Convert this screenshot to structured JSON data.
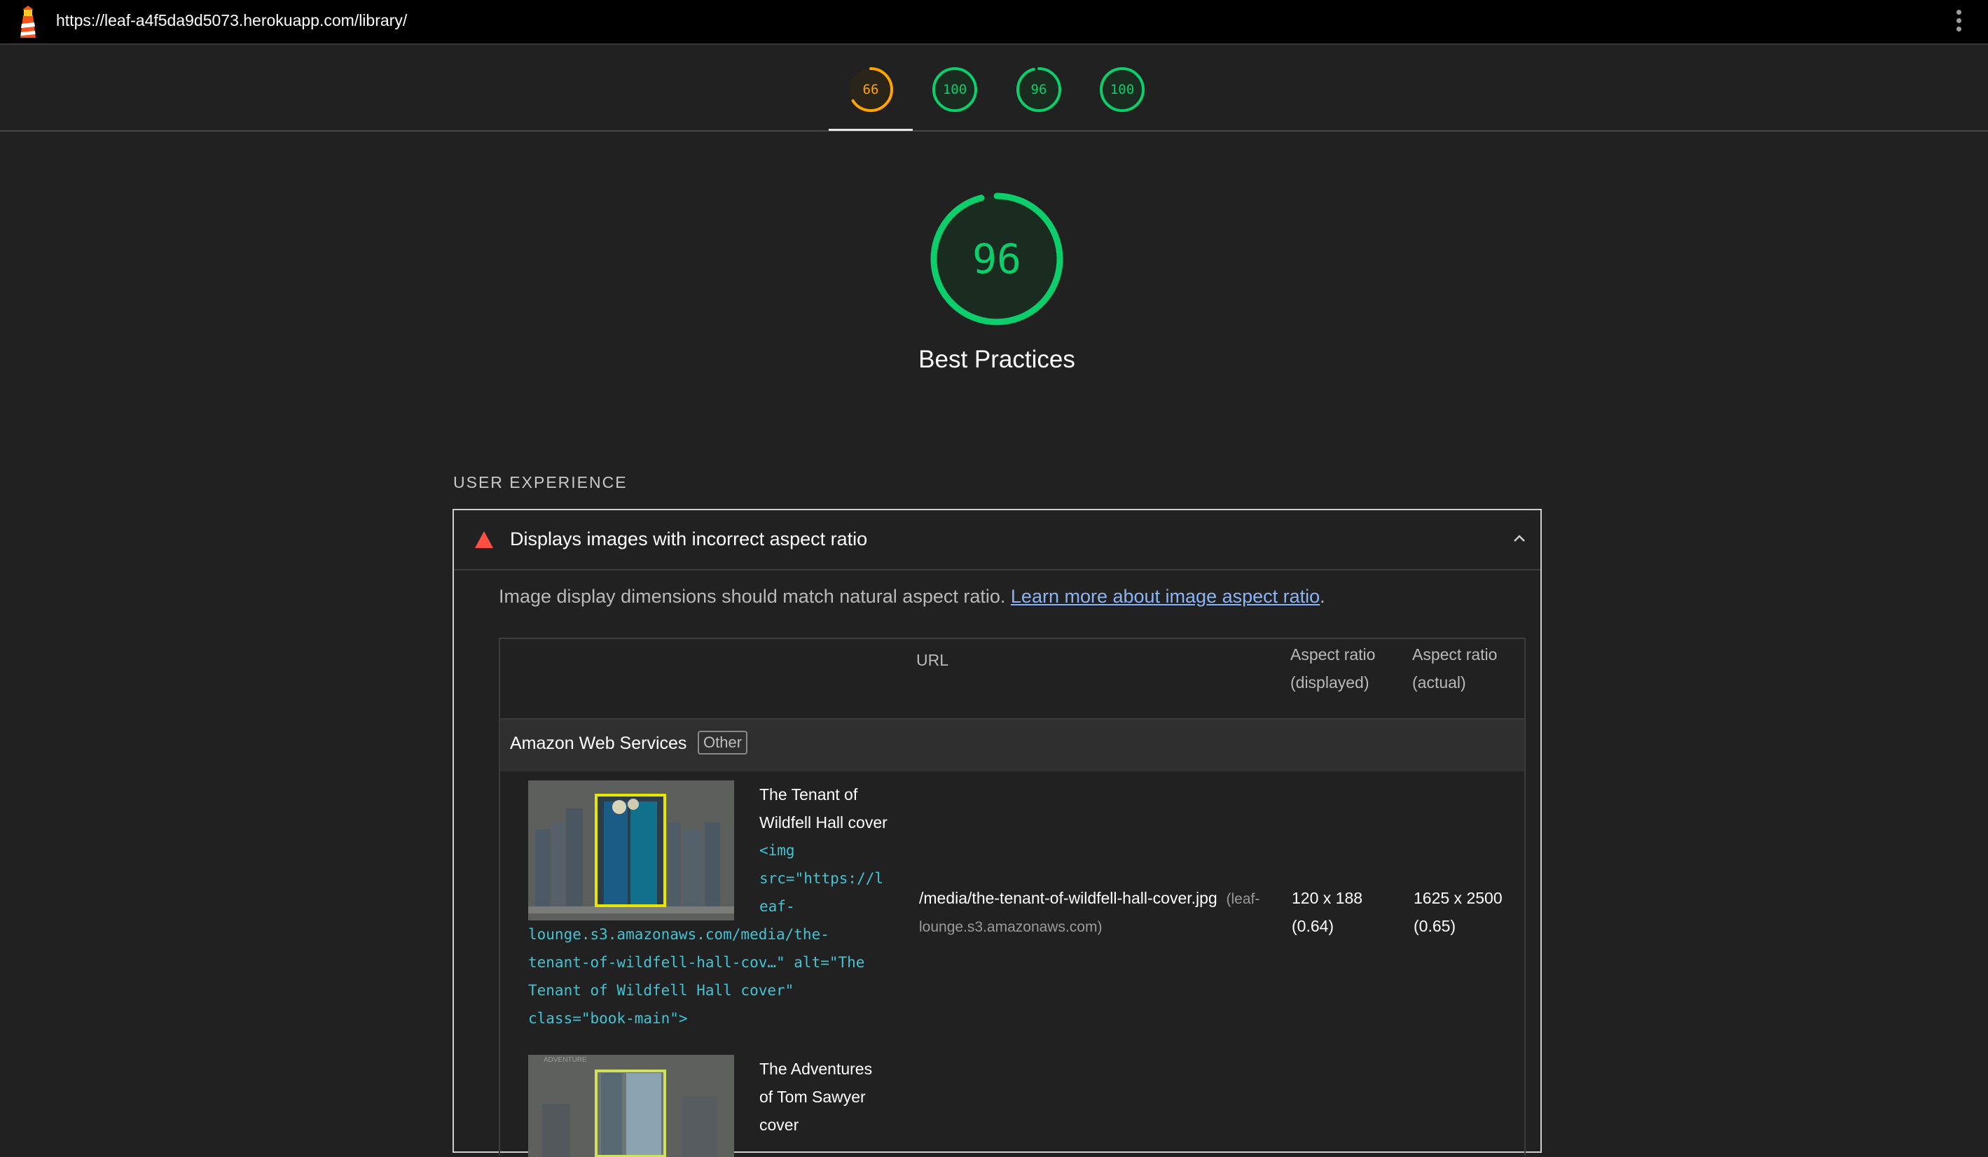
{
  "browser": {
    "url": "https://leaf-a4f5da9d5073.herokuapp.com/library/",
    "logo_icon": "lighthouse-icon",
    "menu_icon": "kebab-menu-icon"
  },
  "category_gauges": [
    {
      "score": "66",
      "value": 66,
      "color": "#ffa400",
      "active": true
    },
    {
      "score": "100",
      "value": 100,
      "color": "#0cce6b",
      "active": false
    },
    {
      "score": "96",
      "value": 96,
      "color": "#0cce6b",
      "active": false
    },
    {
      "score": "100",
      "value": 100,
      "color": "#0cce6b",
      "active": false
    }
  ],
  "main_gauge": {
    "score": "96",
    "value": 96,
    "title": "Best Practices",
    "color": "#0cce6b"
  },
  "section": {
    "title": "USER EXPERIENCE"
  },
  "audit": {
    "title": "Displays images with incorrect aspect ratio",
    "status_icon": "warning-triangle-icon",
    "expand_icon": "chevron-up-icon",
    "description": "Image display dimensions should match natural aspect ratio.",
    "link_text": "Learn more about image aspect ratio",
    "description_end": ".",
    "table": {
      "headers": {
        "url": "URL",
        "displayed_1": "Aspect ratio",
        "displayed_2": "(displayed)",
        "actual_1": "Aspect ratio",
        "actual_2": "(actual)"
      },
      "group": {
        "name": "Amazon Web Services",
        "badge": "Other"
      },
      "rows": [
        {
          "label_lines": [
            "The Tenant of",
            "Wildfell Hall cover"
          ],
          "code_lines": [
            "<img",
            "src=\"https://l",
            "eaf-",
            "lounge.s3.amazonaws.com/media/the-",
            "tenant-of-wildfell-hall-cov…\" alt=\"The",
            "Tenant of Wildfell Hall cover\"",
            "class=\"book-main\">"
          ],
          "url_path": "/media/the-tenant-of-wildfell-hall-cover.jpg",
          "url_host_1": "(leaf-",
          "url_host_2": "lounge.s3.amazonaws.com)",
          "displayed_1": "120 x 188",
          "displayed_2": "(0.64)",
          "actual_1": "1625 x 2500",
          "actual_2": "(0.65)"
        },
        {
          "label_lines": [
            "The Adventures",
            "of Tom Sawyer",
            "cover"
          ],
          "thumb_caption": "ADVENTURE"
        }
      ]
    }
  }
}
